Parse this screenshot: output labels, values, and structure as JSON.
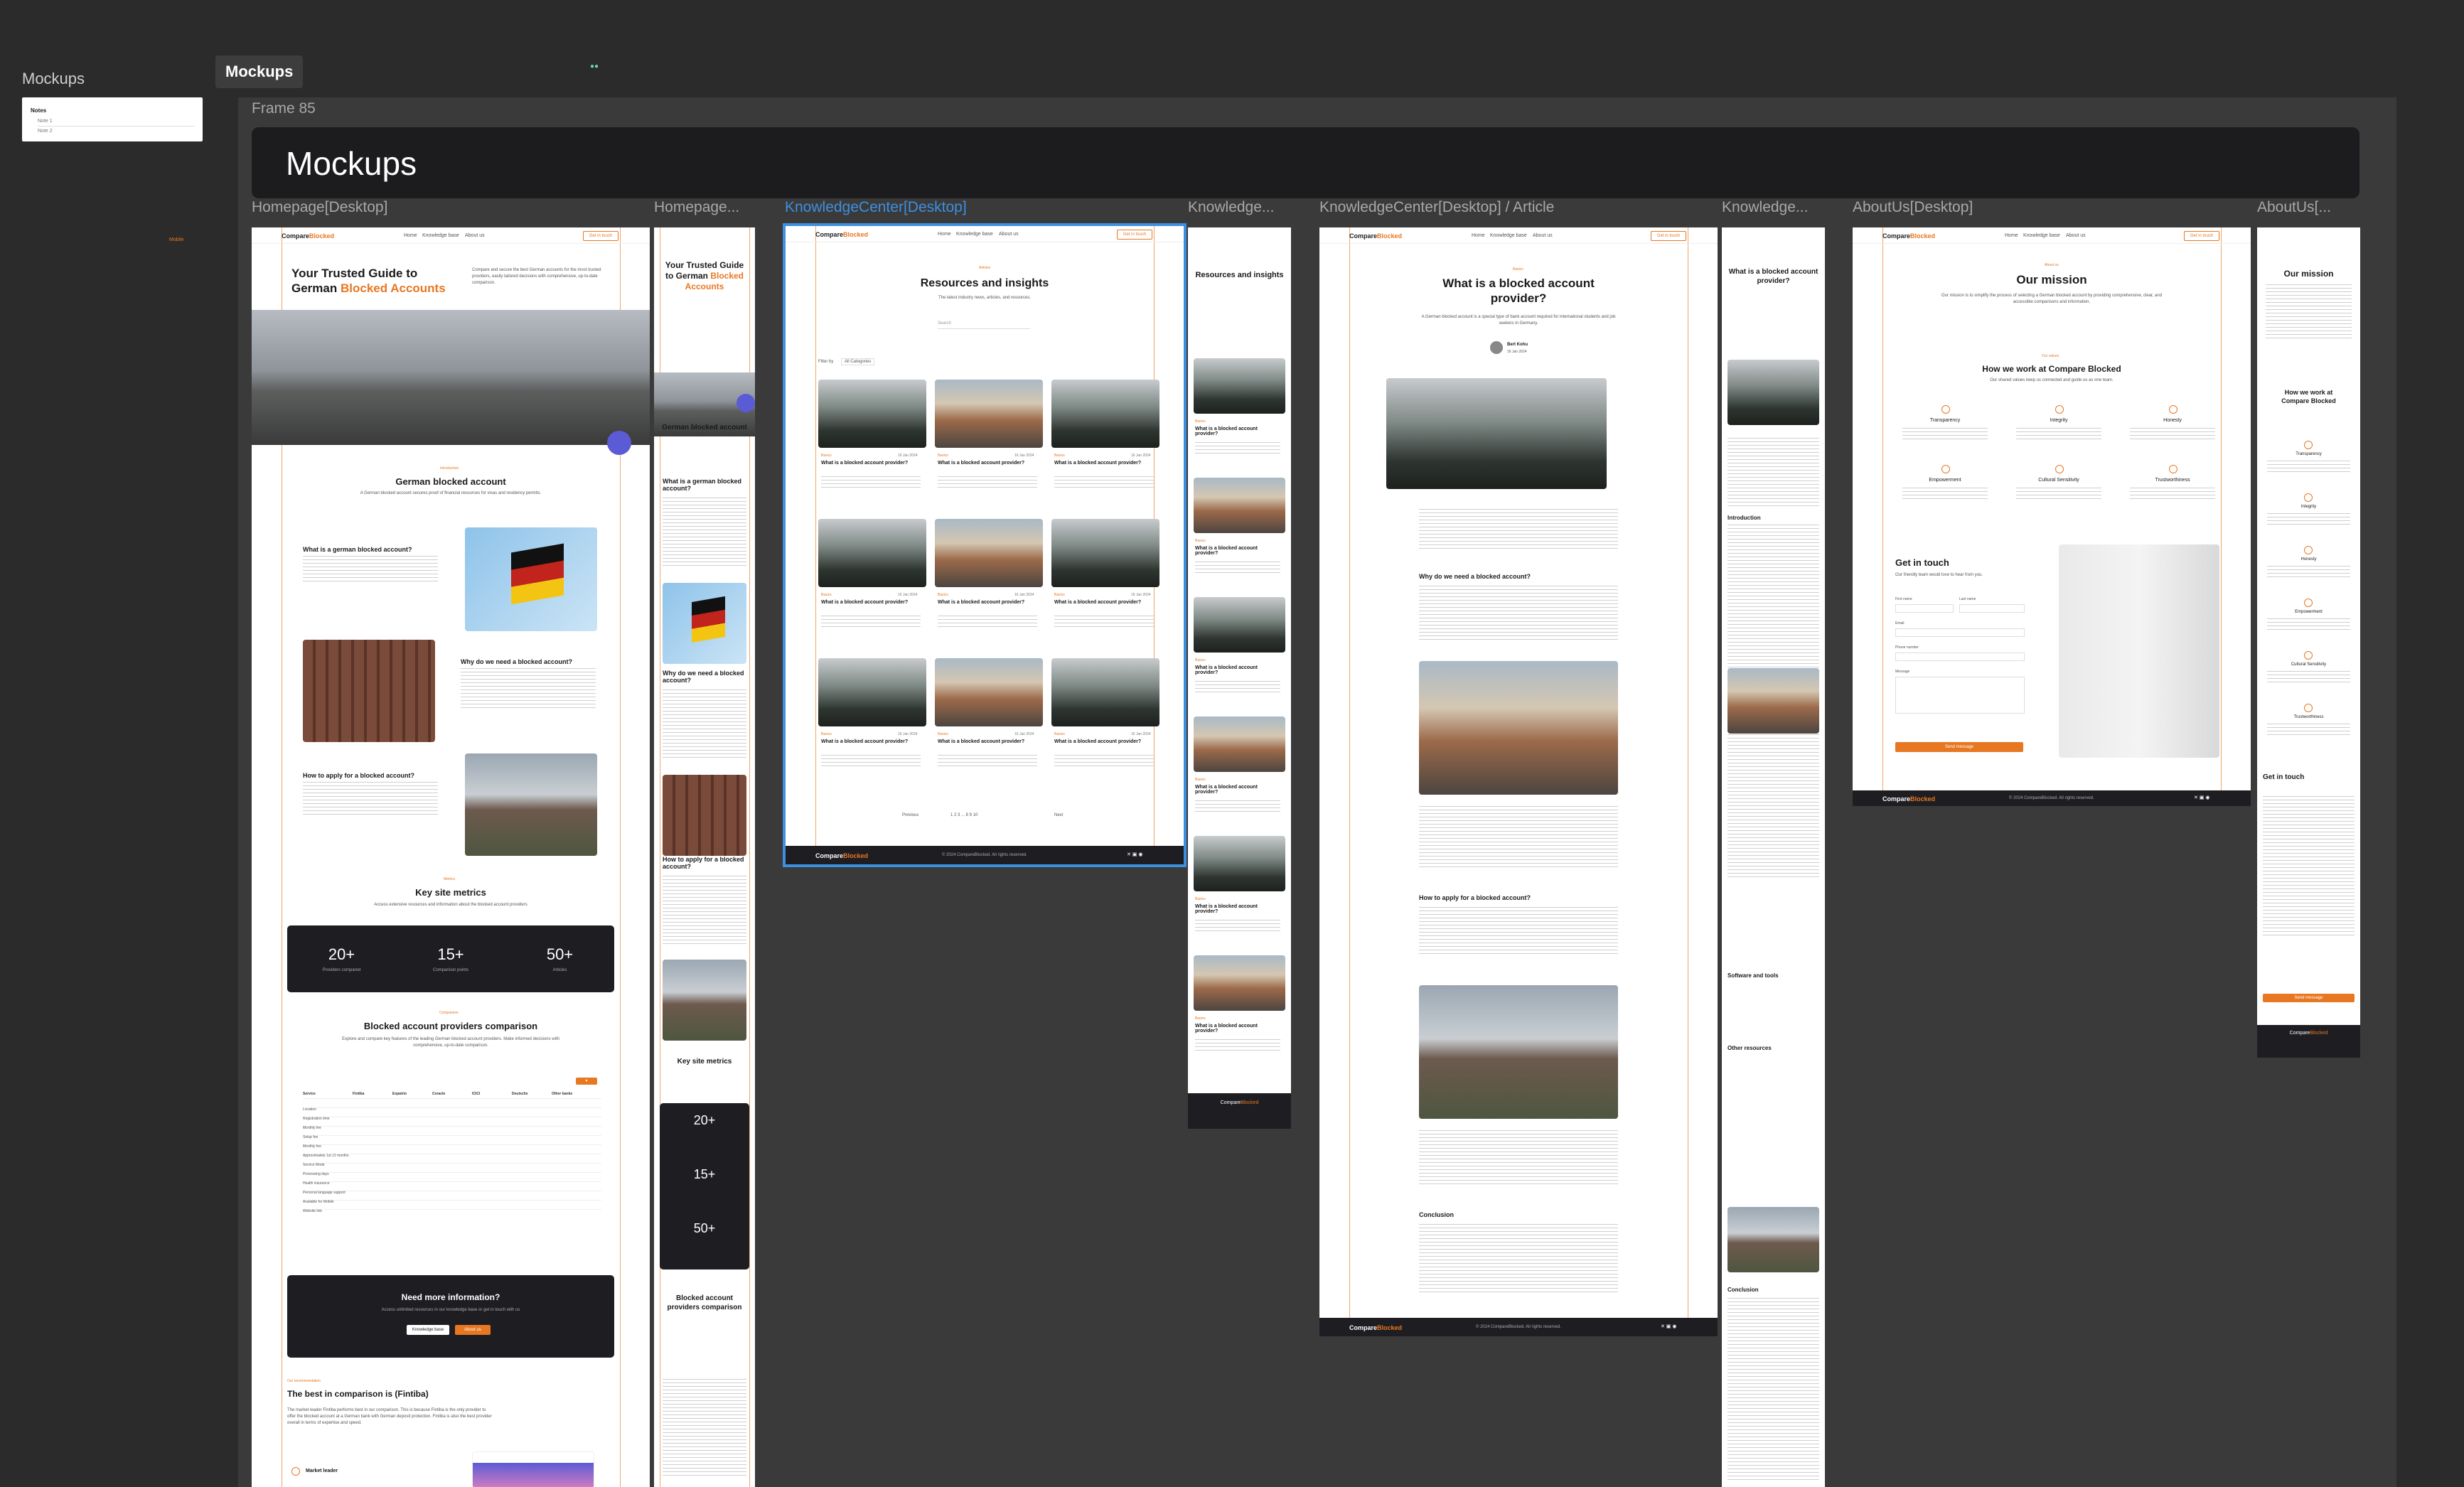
{
  "sidebar": {
    "title": "Mockups",
    "thumb_title": "Notes",
    "thumb_item1": "Note 1",
    "thumb_item2": "Note 2",
    "orange_tag": "Mobile"
  },
  "canvas_tag": "Mockups",
  "frame_label": "Frame 85",
  "banner_title": "Mockups",
  "frames": {
    "home_desktop": "Homepage[Desktop]",
    "home_mobile": "Homepage...",
    "kc_desktop": "KnowledgeCenter[Desktop]",
    "kc_mobile": "Knowledge...",
    "article_desktop": "KnowledgeCenter[Desktop] / Article",
    "article_mobile": "Knowledge...",
    "about_desktop": "AboutUs[Desktop]",
    "about_mobile": "AboutUs[..."
  },
  "brand": {
    "a": "Compare",
    "b": "Blocked"
  },
  "nav": {
    "home": "Home",
    "kc": "Knowledge base",
    "about": "About us",
    "cta": "Get in touch"
  },
  "home": {
    "hero_a": "Your Trusted Guide to",
    "hero_b": "German ",
    "hero_c": "Blocked Accounts",
    "hero_text": "Compare and secure the best German accounts for the most trusted providers, easily tailored decisions with comprehensive, up-to-date comparison.",
    "eyebrow1": "Introduction",
    "section1": "German blocked account",
    "section1_text": "A German blocked account secures proof of financial resources for visas and residency permits.",
    "q1": "What is a german blocked account?",
    "q2": "Why do we need a blocked account?",
    "q3": "How to apply for a blocked account?",
    "eyebrow2": "Metrics",
    "metrics_title": "Key site metrics",
    "metrics_text": "Access extensive resources and information about the blocked account providers",
    "stats": [
      {
        "n": "20+",
        "l": "Providers compared"
      },
      {
        "n": "15+",
        "l": "Comparison points"
      },
      {
        "n": "50+",
        "l": "Articles"
      }
    ],
    "eyebrow3": "Comparison",
    "compare_title": "Blocked account providers comparison",
    "compare_text": "Explore and compare key features of the leading German blocked account providers. Make informed decisions with comprehensive, up-to-date comparison.",
    "table_head": [
      "Service",
      "Fintiba",
      "Expatrio",
      "Coracle",
      "ICICI",
      "Deutsche",
      "Other banks"
    ],
    "table_rows": [
      "Location",
      "Registration time",
      "Monthly fee",
      "Setup fee",
      "Monthly fee",
      "Approximately 1st 12 months",
      "Service Mode",
      "Processing days",
      "Health insurance",
      "Personal language support",
      "Available for Mobile",
      "Website link"
    ],
    "more_title": "Need more information?",
    "more_text": "Access unlimited resources in our knowledge base or get in touch with us",
    "btn_kb": "Knowledge base",
    "btn_about": "About us",
    "eyebrow4": "Our recommendation",
    "best_title": "The best in comparison is (Fintiba)",
    "best_text": "The market leader Fintiba performs best in our comparison. This is because Fintiba is the only provider to offer the blocked account at a German bank with German deposit protection. Fintiba is also the best provider overall in terms of expertise and speed.",
    "market_leader": "Market leader"
  },
  "kc": {
    "eyebrow": "Articles",
    "title": "Resources and insights",
    "sub": "The latest industry news, articles, and resources.",
    "search": "Search",
    "filter": "Filter by",
    "cat": "All Categories",
    "card_badge": "Basics",
    "card_date": "16 Jan 2024",
    "card_title": "What is a blocked account provider?",
    "prev": "Previous",
    "next": "Next",
    "pages": "1 2 3 ... 8 9 10",
    "footer": "© 2024 CompareBlocked. All rights reserved."
  },
  "article": {
    "eyebrow": "Basics",
    "title_a": "What is a blocked account",
    "title_b": "provider?",
    "sub": "A German blocked account is a special type of bank account required for international students and job seekers in Germany.",
    "author": "Bert Kohu",
    "date": "16 Jan 2024",
    "h_why": "Why do we need a blocked account?",
    "h_apply": "How to apply for a blocked account?",
    "h_conc": "Conclusion",
    "m_intro": "Introduction",
    "m_soft": "Software and tools",
    "m_other": "Other resources",
    "m_conc": "Conclusion"
  },
  "about": {
    "eyebrow": "About us",
    "title": "Our mission",
    "text": "Our mission is to simplify the process of selecting a German blocked account by providing comprehensive, clear, and accessible comparisons and information.",
    "eyebrow2": "Our values",
    "work_title": "How we work at Compare Blocked",
    "work_sub": "Our shared values keep us connected and guide us as one team.",
    "values": [
      "Transparency",
      "Integrity",
      "Honesty",
      "Empowerment",
      "Cultural Sensitivity",
      "Trustworthiness"
    ],
    "contact_title": "Get in touch",
    "contact_sub": "Our friendly team would love to hear from you.",
    "f_first": "First name",
    "f_last": "Last name",
    "f_email": "Email",
    "f_phone": "Phone number",
    "f_msg": "Message",
    "send": "Send message",
    "m_work_a": "How we work at",
    "m_work_b": "Compare Blocked"
  }
}
